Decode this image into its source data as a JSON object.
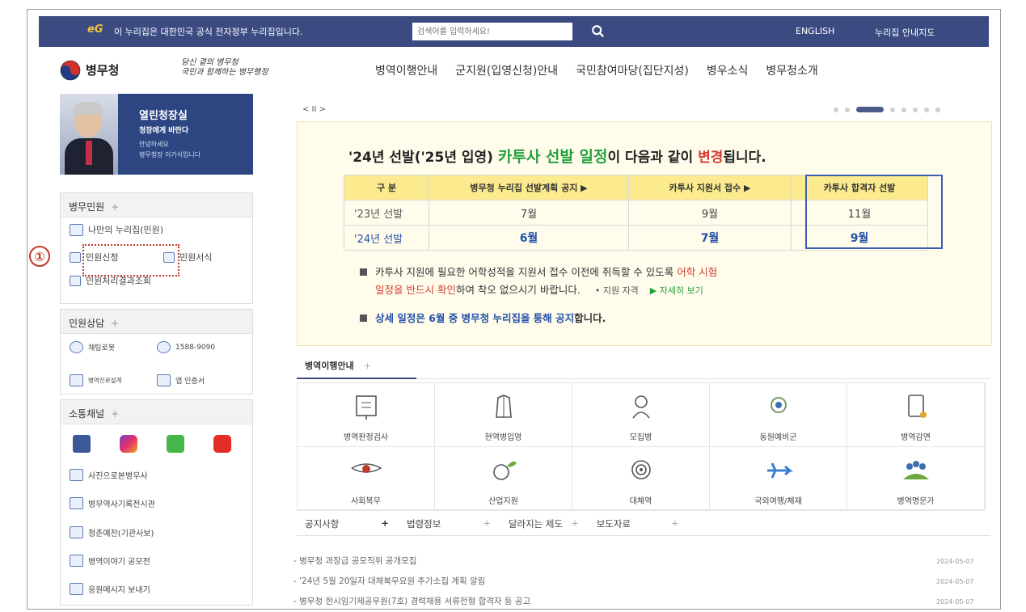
{
  "topbar": {
    "logo": "eG",
    "notice": "이 누리집은 대한민국 공식 전자정부 누리집입니다.",
    "search_placeholder": "검색어를 입력하세요!",
    "english": "ENGLISH",
    "sitemap": "누리집 안내지도",
    "bg_color": "#3b4b82"
  },
  "header": {
    "logo_text": "병무청",
    "slogan_line1": "당신 곁의 병무청",
    "slogan_line2": "국민과 함께하는 병무행정",
    "nav": [
      "병역이행안내",
      "군지원(입영신청)안내",
      "국민참여마당(집단지성)",
      "병우소식",
      "병무청소개"
    ]
  },
  "ceo": {
    "title": "열린청장실",
    "subtitle": "청장에게 바란다",
    "line1": "안녕하세요",
    "line2": "병무청장 이기식입니다"
  },
  "sidebar": {
    "civil": {
      "title": "병무민원",
      "plus": "+",
      "my_page": "나만의 누리집(민원)",
      "apply": "민원신청",
      "forms": "민원서식",
      "result": "민원처리결과조회",
      "marker": "①"
    },
    "consult": {
      "title": "민원상담",
      "plus": "+",
      "chatbot": "채팅로봇",
      "phone": "1588-9090",
      "diagnosis": "병역진로설계",
      "app_cert": "앱 인증서"
    },
    "channel": {
      "title": "소통채널",
      "plus": "+",
      "links": [
        "사진으로본병무사",
        "병무역사기록전시관",
        "청춘예찬(기관사보)",
        "병역이야기 공모전",
        "응원메시지 보내기"
      ]
    }
  },
  "carousel": {
    "controls": "< II >",
    "slides": 8,
    "active_slide": 3
  },
  "banner": {
    "title_pre": "'24년 선발('25년 입영) ",
    "title_green": "카투사 선발 일정",
    "title_mid": "이 다음과 같이 ",
    "title_red": "변경",
    "title_post": "됩니다.",
    "table": {
      "headers": [
        "구    분",
        "병무청 누리집 선발계획 공지 ▶",
        "카투사 지원서 접수 ▶",
        "카투사 합격자 선발"
      ],
      "rows": [
        {
          "label": "'23년 선발",
          "values": [
            "7월",
            "9월",
            "11월"
          ]
        },
        {
          "label": "'24년 선발",
          "values": [
            "6월",
            "7월",
            "9월"
          ]
        }
      ]
    },
    "note1_a": "카투사 지원에 필요한 어학성적을 지원서 접수 이전에 취득할 수 있도록 ",
    "note1_red1": "어학 시험",
    "note1_red2": "일정을 반드시 확인",
    "note1_b": "하여 착오 없으시기 바랍니다.",
    "note1_qual": "• 지원 자격",
    "note1_more": "▶ 자세히 보기",
    "note2_blue": "상세 일정은 6월 중 병무청 누리집을 통해 공지",
    "note2_post": "합니다."
  },
  "services": {
    "tab": "병역이행안내",
    "plus": "+",
    "items": [
      {
        "label": "병역판정검사",
        "icon": "exam-icon"
      },
      {
        "label": "현역병입영",
        "icon": "uniform-icon"
      },
      {
        "label": "모집병",
        "icon": "recruit-icon"
      },
      {
        "label": "동원예비군",
        "icon": "reserve-icon"
      },
      {
        "label": "병역감면",
        "icon": "document-icon"
      },
      {
        "label": "사회복무",
        "icon": "emblem-icon"
      },
      {
        "label": "산업지원",
        "icon": "gear-leaf-icon"
      },
      {
        "label": "대체역",
        "icon": "target-icon"
      },
      {
        "label": "국외여행/체재",
        "icon": "airplane-icon"
      },
      {
        "label": "병역명문가",
        "icon": "family-icon"
      }
    ]
  },
  "notices": {
    "tabs": [
      "공지사항",
      "법령정보",
      "달라지는 제도",
      "보도자료"
    ],
    "items": [
      {
        "title": "병무청 과장급 공모직위 공개모집",
        "date": "2024-05-07"
      },
      {
        "title": "'24년 5월 20일자 대체복무요원 추가소집 계획 알림",
        "date": "2024-05-07"
      },
      {
        "title": "병무청 한시임기제공무원(7호) 경력채용 서류전형 합격자 등 공고",
        "date": "2024-05-07"
      }
    ]
  }
}
